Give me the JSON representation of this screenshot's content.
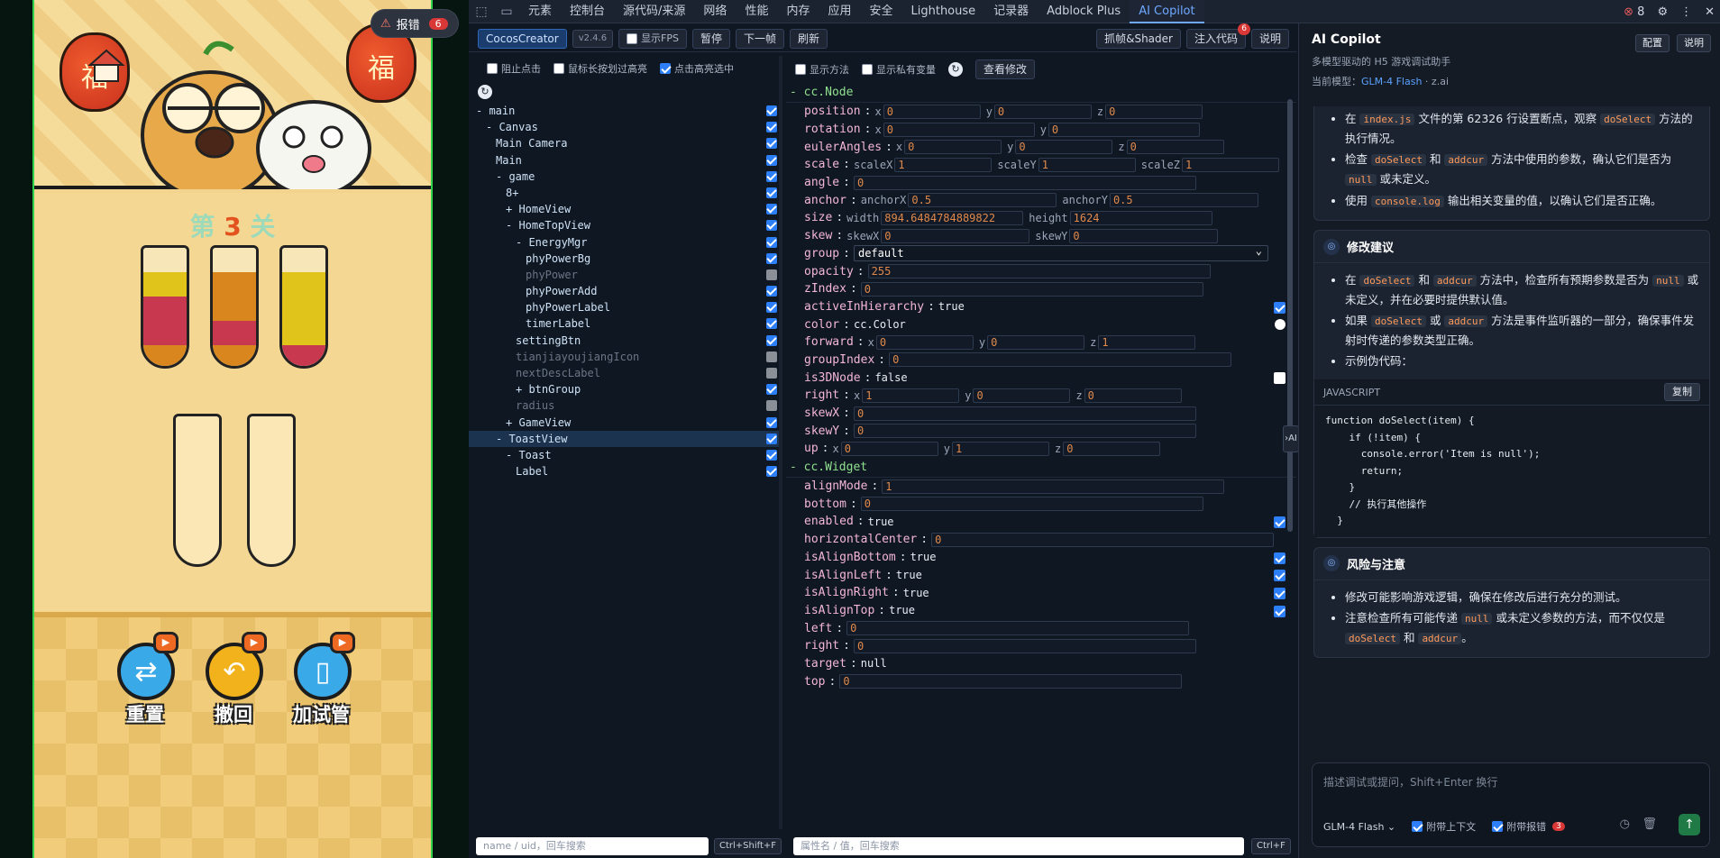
{
  "game": {
    "error_badge": {
      "label": "报错",
      "count": "6"
    },
    "level": {
      "prefix": "第",
      "number": "3",
      "suffix": "关"
    },
    "lanterns": [
      "福",
      "福"
    ],
    "tubes_top": [
      {
        "segments": [
          {
            "color": "#f7e7b8",
            "size": 1
          },
          {
            "color": "#e0c41b",
            "size": 1
          },
          {
            "color": "#c8394f",
            "size": 2
          },
          {
            "color": "#d9861f",
            "size": 1
          }
        ]
      },
      {
        "segments": [
          {
            "color": "#f7e7b8",
            "size": 1
          },
          {
            "color": "#d9861f",
            "size": 2
          },
          {
            "color": "#c8394f",
            "size": 1
          },
          {
            "color": "#d9861f",
            "size": 1
          }
        ]
      },
      {
        "segments": [
          {
            "color": "#f7e7b8",
            "size": 1
          },
          {
            "color": "#e0c41b",
            "size": 3
          },
          {
            "color": "#c8394f",
            "size": 1
          }
        ]
      }
    ],
    "tubes_bottom": 2,
    "buttons": [
      {
        "label": "重置",
        "icon": "refresh-icon",
        "color": "#3aa9e8"
      },
      {
        "label": "撤回",
        "icon": "undo-icon",
        "color": "#f2b21b"
      },
      {
        "label": "加试管",
        "icon": "test-tube-icon",
        "color": "#3aa9e8"
      }
    ]
  },
  "devtools": {
    "tabs": [
      "元素",
      "控制台",
      "源代码/来源",
      "网络",
      "性能",
      "内存",
      "应用",
      "安全",
      "Lighthouse",
      "记录器",
      "Adblock Plus",
      "AI Copilot"
    ],
    "active_tab": "AI Copilot",
    "error_count": "8",
    "toolbar": {
      "cocos": "CocosCreator",
      "version": "v2.4.6",
      "show_fps": "显示FPS",
      "pause": "暂停",
      "next_frame": "下一帧",
      "refresh": "刷新",
      "capture": "抓帧&Shader",
      "inject": "注入代码",
      "inject_badge": "6",
      "help": "说明"
    },
    "tree_options": {
      "block_click": "阻止点击",
      "long_press": "鼠标长按划过高亮",
      "click_highlight": "点击高亮选中"
    },
    "tree": [
      {
        "label": "- main",
        "indent": 0,
        "on": true
      },
      {
        "label": "- Canvas",
        "indent": 1,
        "on": true
      },
      {
        "label": "Main Camera",
        "indent": 2,
        "on": true
      },
      {
        "label": "Main",
        "indent": 2,
        "on": true
      },
      {
        "label": "- game",
        "indent": 2,
        "on": true
      },
      {
        "label": "8+",
        "indent": 3,
        "on": true
      },
      {
        "label": "+ HomeView",
        "indent": 3,
        "on": true
      },
      {
        "label": "- HomeTopView",
        "indent": 3,
        "on": true
      },
      {
        "label": "- EnergyMgr",
        "indent": 4,
        "on": true
      },
      {
        "label": "phyPowerBg",
        "indent": 5,
        "on": true
      },
      {
        "label": "phyPower",
        "indent": 5,
        "on": false
      },
      {
        "label": "phyPowerAdd",
        "indent": 5,
        "on": true
      },
      {
        "label": "phyPowerLabel",
        "indent": 5,
        "on": true
      },
      {
        "label": "timerLabel",
        "indent": 5,
        "on": true
      },
      {
        "label": "settingBtn",
        "indent": 4,
        "on": true
      },
      {
        "label": "tianjiayoujiangIcon",
        "indent": 4,
        "on": false
      },
      {
        "label": "nextDescLabel",
        "indent": 4,
        "on": false
      },
      {
        "label": "+ btnGroup",
        "indent": 4,
        "on": true
      },
      {
        "label": "radius",
        "indent": 4,
        "on": false
      },
      {
        "label": "+ GameView",
        "indent": 3,
        "on": true
      },
      {
        "label": "- ToastView",
        "indent": 2,
        "on": true,
        "selected": true
      },
      {
        "label": "- Toast",
        "indent": 3,
        "on": true
      },
      {
        "label": "Label",
        "indent": 4,
        "on": true
      }
    ],
    "tree_search": {
      "placeholder": "name / uid，回车搜索",
      "shortcut": "Ctrl+Shift+F"
    },
    "props_options": {
      "show_methods": "显示方法",
      "show_private": "显示私有变量",
      "view_changes": "查看修改"
    },
    "node_section": "- cc.Node",
    "node_props": [
      {
        "key": "position",
        "fields": [
          [
            "x",
            "0"
          ],
          [
            "y",
            "0"
          ],
          [
            "z",
            "0"
          ]
        ]
      },
      {
        "key": "rotation",
        "fields": [
          [
            "x",
            "0"
          ],
          [
            "y",
            "0"
          ]
        ]
      },
      {
        "key": "eulerAngles",
        "fields": [
          [
            "x",
            "0"
          ],
          [
            "y",
            "0"
          ],
          [
            "z",
            "0"
          ]
        ]
      },
      {
        "key": "scale",
        "fields": [
          [
            "scaleX",
            "1"
          ],
          [
            "scaleY",
            "1"
          ],
          [
            "scaleZ",
            "1"
          ]
        ]
      },
      {
        "key": "angle",
        "fields": [
          [
            "",
            "0"
          ]
        ]
      },
      {
        "key": "anchor",
        "fields": [
          [
            "anchorX",
            "0.5"
          ],
          [
            "anchorY",
            "0.5"
          ]
        ]
      },
      {
        "key": "size",
        "fields": [
          [
            "width",
            "894.6484784889822"
          ],
          [
            "height",
            "1624"
          ]
        ]
      },
      {
        "key": "skew",
        "fields": [
          [
            "skewX",
            "0"
          ],
          [
            "skewY",
            "0"
          ]
        ]
      },
      {
        "key": "group",
        "select": "default"
      },
      {
        "key": "opacity",
        "fields": [
          [
            "",
            "255"
          ]
        ]
      },
      {
        "key": "zIndex",
        "fields": [
          [
            "",
            "0"
          ]
        ]
      },
      {
        "key": "activeInHierarchy",
        "text": "true",
        "check": true
      },
      {
        "key": "color",
        "text": "cc.Color",
        "dot": true
      },
      {
        "key": "forward",
        "fields": [
          [
            "x",
            "0"
          ],
          [
            "y",
            "0"
          ],
          [
            "z",
            "1"
          ]
        ]
      },
      {
        "key": "groupIndex",
        "fields": [
          [
            "",
            "0"
          ]
        ]
      },
      {
        "key": "is3DNode",
        "text": "false",
        "check": false
      },
      {
        "key": "right",
        "fields": [
          [
            "x",
            "1"
          ],
          [
            "y",
            "0"
          ],
          [
            "z",
            "0"
          ]
        ]
      },
      {
        "key": "skewX",
        "fields": [
          [
            "",
            "0"
          ]
        ]
      },
      {
        "key": "skewY",
        "fields": [
          [
            "",
            "0"
          ]
        ]
      },
      {
        "key": "up",
        "fields": [
          [
            "x",
            "0"
          ],
          [
            "y",
            "1"
          ],
          [
            "z",
            "0"
          ]
        ]
      }
    ],
    "widget_section": "- cc.Widget",
    "widget_props": [
      {
        "key": "alignMode",
        "fields": [
          [
            "",
            "1"
          ]
        ]
      },
      {
        "key": "bottom",
        "fields": [
          [
            "",
            "0"
          ]
        ]
      },
      {
        "key": "enabled",
        "text": "true",
        "check": true
      },
      {
        "key": "horizontalCenter",
        "fields": [
          [
            "",
            "0"
          ]
        ]
      },
      {
        "key": "isAlignBottom",
        "text": "true",
        "check": true
      },
      {
        "key": "isAlignLeft",
        "text": "true",
        "check": true
      },
      {
        "key": "isAlignRight",
        "text": "true",
        "check": true
      },
      {
        "key": "isAlignTop",
        "text": "true",
        "check": true
      },
      {
        "key": "left",
        "fields": [
          [
            "",
            "0"
          ]
        ]
      },
      {
        "key": "right",
        "fields": [
          [
            "",
            "0"
          ]
        ]
      },
      {
        "key": "target",
        "text": "null"
      },
      {
        "key": "top",
        "fields": [
          [
            "",
            "0"
          ]
        ]
      }
    ],
    "prop_search": {
      "placeholder": "属性名 / 值，回车搜索",
      "shortcut": "Ctrl+F"
    }
  },
  "copilot": {
    "title": "AI Copilot",
    "subtitle": "多模型驱动的 H5 游戏调试助手",
    "model_prefix": "当前模型：",
    "model_name": "GLM-4 Flash",
    "model_suffix": " · z.ai",
    "config_btn": "配置",
    "help_btn": "说明",
    "card1_items": [
      [
        "在 ",
        "index.js",
        " 文件的第 62326 行设置断点，观察 ",
        "doSelect",
        " 方法的执行情况。"
      ],
      [
        "检查 ",
        "doSelect",
        " 和 ",
        "addcur",
        " 方法中使用的参数，确认它们是否为 ",
        "null",
        " 或未定义。"
      ],
      [
        "使用 ",
        "console.log",
        " 输出相关变量的值，以确认它们是否正确。"
      ]
    ],
    "card2_title": "修改建议",
    "card2_items": [
      [
        "在 ",
        "doSelect",
        " 和 ",
        "addcur",
        " 方法中，检查所有预期参数是否为 ",
        "null",
        " 或未定义，并在必要时提供默认值。"
      ],
      [
        "如果 ",
        "doSelect",
        " 或 ",
        "addcur",
        " 方法是事件监听器的一部分，确保事件发射时传递的参数类型正确。"
      ],
      [
        "示例伪代码："
      ]
    ],
    "code_lang": "JAVASCRIPT",
    "code_copy": "复制",
    "code": "function doSelect(item) {\n    if (!item) {\n      console.error('Item is null');\n      return;\n    }\n    // 执行其他操作\n  }",
    "card3_title": "风险与注意",
    "card3_items": [
      [
        "修改可能影响游戏逻辑，确保在修改后进行充分的测试。"
      ],
      [
        "注意检查所有可能传递 ",
        "null",
        " 或未定义参数的方法，而不仅仅是 ",
        "doSelect",
        " 和 ",
        "addcur",
        "。"
      ]
    ],
    "input_placeholder": "描述调试或提问，Shift+Enter 换行",
    "model_select": "GLM-4 Flash",
    "attach_context": "附带上下文",
    "attach_errors": "附带报错",
    "attach_errors_count": "3"
  }
}
